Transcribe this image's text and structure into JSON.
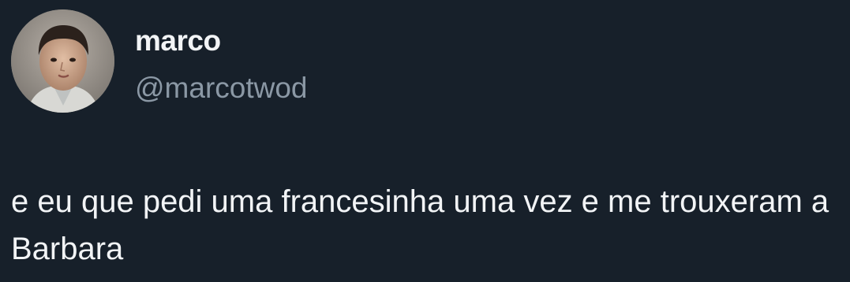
{
  "tweet": {
    "author": {
      "display_name": "marco",
      "handle": "@marcotwod",
      "avatar_icon": "avatar-photo"
    },
    "text": "e eu que pedi uma francesinha uma vez e me trouxeram a Barbara"
  },
  "colors": {
    "background": "#17202a",
    "primary_text": "#f2f4f6",
    "secondary_text": "#8b98a5"
  }
}
